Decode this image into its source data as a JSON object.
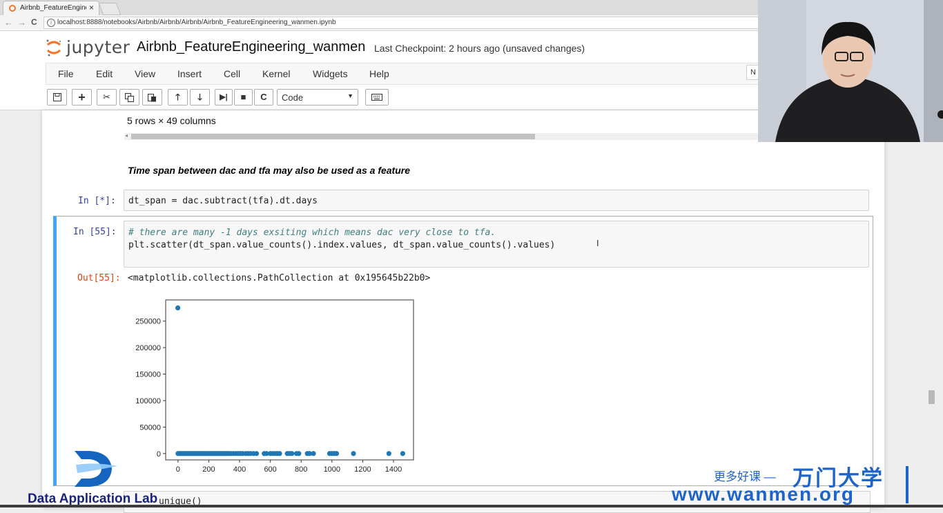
{
  "browser": {
    "tab_title": "Airbnb_FeatureEnginee",
    "tab_close": "×",
    "url": "localhost:8888/notebooks/Airbnb/Airbnb/Airbnb/Airbnb_FeatureEngineering_wanmen.ipynb",
    "back_glyph": "←",
    "forward_glyph": "→",
    "reload_glyph": "C"
  },
  "jupyter": {
    "logo_text": "jupyter",
    "notebook_title": "Airbnb_FeatureEngineering_wanmen",
    "checkpoint": "Last Checkpoint: 2 hours ago (unsaved changes)",
    "menu": [
      "File",
      "Edit",
      "View",
      "Insert",
      "Cell",
      "Kernel",
      "Widgets",
      "Help"
    ],
    "kernel_indicator": "N",
    "toolbar": {
      "save": "save-icon",
      "add": "+",
      "cut": "✂",
      "copy": "copy-icon",
      "paste": "paste-icon",
      "up": "🡑",
      "down": "🡓",
      "run": "▶|",
      "stop": "■",
      "restart": "C",
      "keyboard": "keyboard-icon"
    },
    "cell_type": "Code"
  },
  "notebook": {
    "df_shape": "5 rows × 49 columns",
    "markdown": "Time span between dac and tfa may also be used as a feature",
    "cell1": {
      "prompt": "In  [*]:",
      "code": "dt_span = dac.subtract(tfa).dt.days"
    },
    "cell2": {
      "prompt": "In  [55]:",
      "comment": "# there are many -1 days exsiting which means dac very close to tfa.",
      "code": "plt.scatter(dt_span.value_counts().index.values, dt_span.value_counts().values)",
      "out_prompt": "Out[55]:",
      "out_text": "<matplotlib.collections.PathCollection at 0x195645b22b0>"
    },
    "next_cell_code": "unique()"
  },
  "chart_data": {
    "type": "scatter",
    "xlim": [
      -80,
      1530
    ],
    "ylim": [
      -12000,
      290000
    ],
    "xticks": [
      0,
      200,
      400,
      600,
      800,
      1000,
      1200,
      1400
    ],
    "yticks": [
      0,
      50000,
      100000,
      150000,
      200000,
      250000
    ],
    "xtick_labels": [
      "0",
      "200",
      "400",
      "600",
      "800",
      "1000",
      "1200",
      "1400"
    ],
    "ytick_labels": [
      "0",
      "50000",
      "100000",
      "150000",
      "200000",
      "250000"
    ],
    "color": "#1f77b4",
    "points": [
      [
        -1,
        275000
      ],
      [
        0,
        0
      ],
      [
        10,
        0
      ],
      [
        20,
        0
      ],
      [
        30,
        0
      ],
      [
        40,
        0
      ],
      [
        50,
        0
      ],
      [
        60,
        0
      ],
      [
        70,
        0
      ],
      [
        80,
        0
      ],
      [
        90,
        0
      ],
      [
        100,
        0
      ],
      [
        110,
        0
      ],
      [
        120,
        0
      ],
      [
        130,
        0
      ],
      [
        140,
        0
      ],
      [
        150,
        0
      ],
      [
        160,
        0
      ],
      [
        170,
        0
      ],
      [
        180,
        0
      ],
      [
        190,
        0
      ],
      [
        200,
        0
      ],
      [
        210,
        0
      ],
      [
        220,
        0
      ],
      [
        230,
        0
      ],
      [
        240,
        0
      ],
      [
        250,
        0
      ],
      [
        260,
        0
      ],
      [
        270,
        0
      ],
      [
        280,
        0
      ],
      [
        290,
        0
      ],
      [
        300,
        0
      ],
      [
        310,
        0
      ],
      [
        320,
        0
      ],
      [
        330,
        0
      ],
      [
        345,
        0
      ],
      [
        360,
        0
      ],
      [
        375,
        0
      ],
      [
        390,
        0
      ],
      [
        405,
        0
      ],
      [
        420,
        0
      ],
      [
        440,
        0
      ],
      [
        455,
        0
      ],
      [
        470,
        0
      ],
      [
        490,
        0
      ],
      [
        510,
        0
      ],
      [
        560,
        0
      ],
      [
        575,
        0
      ],
      [
        600,
        0
      ],
      [
        615,
        0
      ],
      [
        630,
        0
      ],
      [
        645,
        0
      ],
      [
        660,
        0
      ],
      [
        710,
        0
      ],
      [
        725,
        0
      ],
      [
        740,
        0
      ],
      [
        770,
        0
      ],
      [
        785,
        0
      ],
      [
        840,
        0
      ],
      [
        855,
        0
      ],
      [
        880,
        0
      ],
      [
        985,
        0
      ],
      [
        1000,
        0
      ],
      [
        1015,
        0
      ],
      [
        1030,
        0
      ],
      [
        1140,
        0
      ],
      [
        1370,
        0
      ],
      [
        1460,
        0
      ]
    ]
  },
  "watermark": {
    "dal_text": "Data Application Lab",
    "cn_text": "更多好课 —",
    "brand": "万门大学",
    "url": "www.wanmen.org"
  }
}
